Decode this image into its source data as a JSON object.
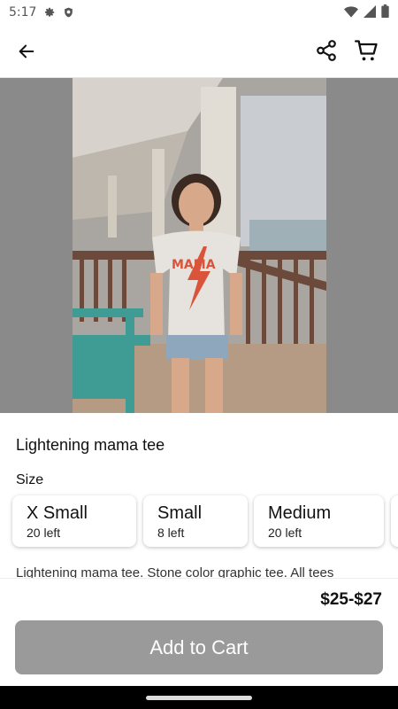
{
  "status_bar": {
    "time": "5:17",
    "icons": [
      "gear-icon",
      "shield-icon",
      "wifi-icon",
      "signal-icon",
      "battery-icon"
    ]
  },
  "app_bar": {
    "icons": [
      "back-arrow-icon",
      "share-icon",
      "cart-icon"
    ]
  },
  "product": {
    "title": "Lightening mama tee",
    "size_label": "Size",
    "sizes": [
      {
        "name": "X Small",
        "left": "20 left"
      },
      {
        "name": "Small",
        "left": "8 left"
      },
      {
        "name": "Medium",
        "left": "20 left"
      }
    ],
    "description": "Lightening mama tee. Stone color graphic tee. All tees",
    "price": "$25-$27",
    "shirt_text": "MAMA"
  },
  "footer": {
    "add_to_cart_label": "Add to Cart"
  },
  "colors": {
    "button_disabled": "#9a9a9a",
    "image_backdrop": "#8a8a8a",
    "shirt_print": "#d9543a"
  }
}
